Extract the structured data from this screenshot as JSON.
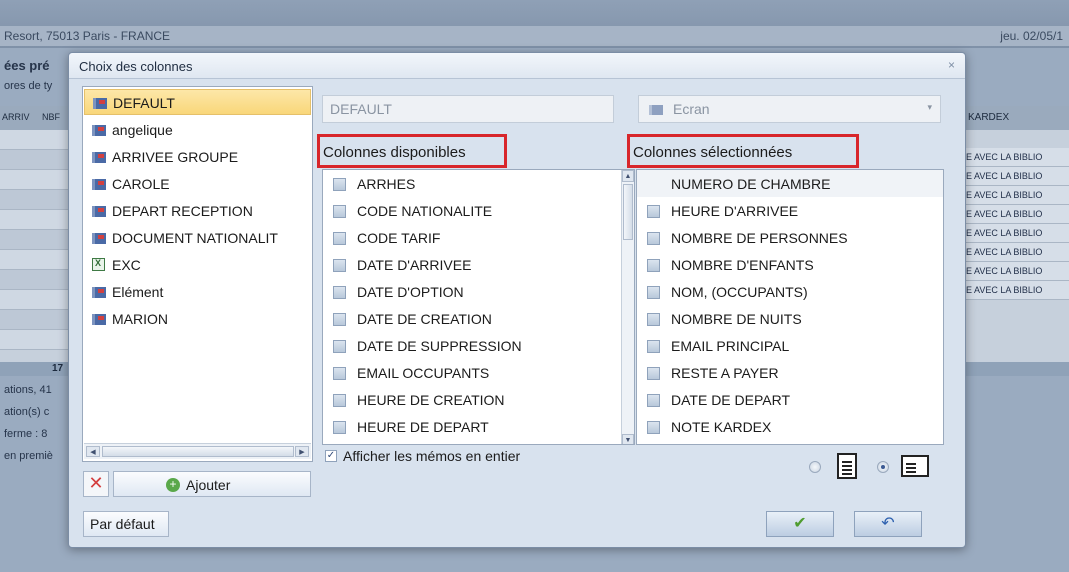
{
  "background": {
    "address": "Resort, 75013 Paris - FRANCE",
    "date": "jeu. 02/05/1",
    "title": "ées pré",
    "subtitle": "ores de ty",
    "grid_headers": [
      "ARRIV",
      "NBF"
    ],
    "total": "17",
    "footer_lines": [
      "ations, 41",
      "ation(s) c",
      "ferme : 8",
      "en premiè"
    ],
    "kardex_header": "KARDEX",
    "kardex_rows": [
      "E AVEC LA BIBLIO",
      "E AVEC LA BIBLIO",
      "E AVEC LA BIBLIO",
      "E AVEC LA BIBLIO",
      "E AVEC LA BIBLIO",
      "E AVEC LA BIBLIO",
      "E AVEC LA BIBLIO",
      "E AVEC LA BIBLIO"
    ]
  },
  "dialog": {
    "title": "Choix des colonnes",
    "close_icon": "×",
    "profiles": [
      {
        "label": "DEFAULT",
        "icon": "folder",
        "selected": true
      },
      {
        "label": "angelique",
        "icon": "folder"
      },
      {
        "label": "ARRIVEE GROUPE",
        "icon": "folder"
      },
      {
        "label": "CAROLE",
        "icon": "folder"
      },
      {
        "label": "DEPART RECEPTION",
        "icon": "folder"
      },
      {
        "label": "DOCUMENT NATIONALIT",
        "icon": "folder"
      },
      {
        "label": "EXC",
        "icon": "excel"
      },
      {
        "label": "Elément",
        "icon": "folder"
      },
      {
        "label": "MARION",
        "icon": "folder"
      }
    ],
    "delete_label": "✕",
    "add_label": "Ajouter",
    "name_value": "DEFAULT",
    "screen_value": "Ecran",
    "available_heading": "Colonnes disponibles",
    "selected_heading": "Colonnes sélectionnées",
    "available_columns": [
      "ARRHES",
      "CODE NATIONALITE",
      "CODE TARIF",
      "DATE D'ARRIVEE",
      "DATE D'OPTION",
      "DATE DE CREATION",
      "DATE DE SUPPRESSION",
      "EMAIL OCCUPANTS",
      "HEURE DE CREATION",
      "HEURE DE DEPART"
    ],
    "selected_columns": [
      "NUMERO DE CHAMBRE",
      "HEURE D'ARRIVEE",
      "NOMBRE DE PERSONNES",
      "NOMBRE D'ENFANTS",
      "NOM, (OCCUPANTS)",
      "NOMBRE DE NUITS",
      "EMAIL PRINCIPAL",
      "RESTE A PAYER",
      "DATE DE DEPART",
      "NOTE KARDEX"
    ],
    "memo_label": "Afficher les mémos en entier",
    "memo_checked": true,
    "default_button": "Par défaut",
    "ok_icon": "✔",
    "undo_icon": "↶"
  }
}
